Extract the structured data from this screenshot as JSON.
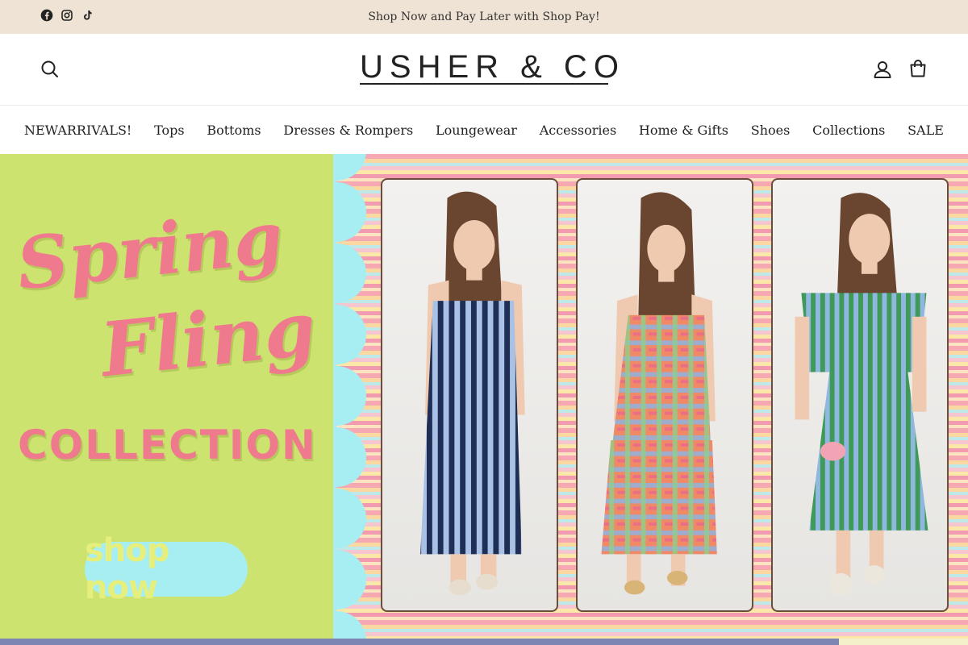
{
  "announcement": {
    "text": "Shop Now and Pay Later with Shop Pay!"
  },
  "socials": [
    {
      "icon": "facebook-icon"
    },
    {
      "icon": "instagram-icon"
    },
    {
      "icon": "tiktok-icon"
    }
  ],
  "header": {
    "logo": "USHER & CO",
    "icons": {
      "search": "search-icon",
      "account": "account-icon",
      "cart": "cart-icon"
    }
  },
  "nav": {
    "items": [
      "NEWARRIVALS!",
      "Tops",
      "Bottoms",
      "Dresses & Rompers",
      "Loungewear",
      "Accessories",
      "Home & Gifts",
      "Shoes",
      "Collections",
      "SALE"
    ]
  },
  "hero": {
    "line1": "Spring",
    "line2": "Fling",
    "line3": "COLLECTION",
    "cta": "shop now",
    "colors": {
      "left_bg": "#cde370",
      "headline": "#ef7a8e",
      "button_bg": "#a6eef1",
      "button_text": "#e7ef7c"
    },
    "photos": [
      {
        "dress": "navy and light blue striped maxi dress"
      },
      {
        "dress": "multicolor plaid tiered maxi dress"
      },
      {
        "dress": "green and blue striped top and skirt set"
      }
    ]
  }
}
